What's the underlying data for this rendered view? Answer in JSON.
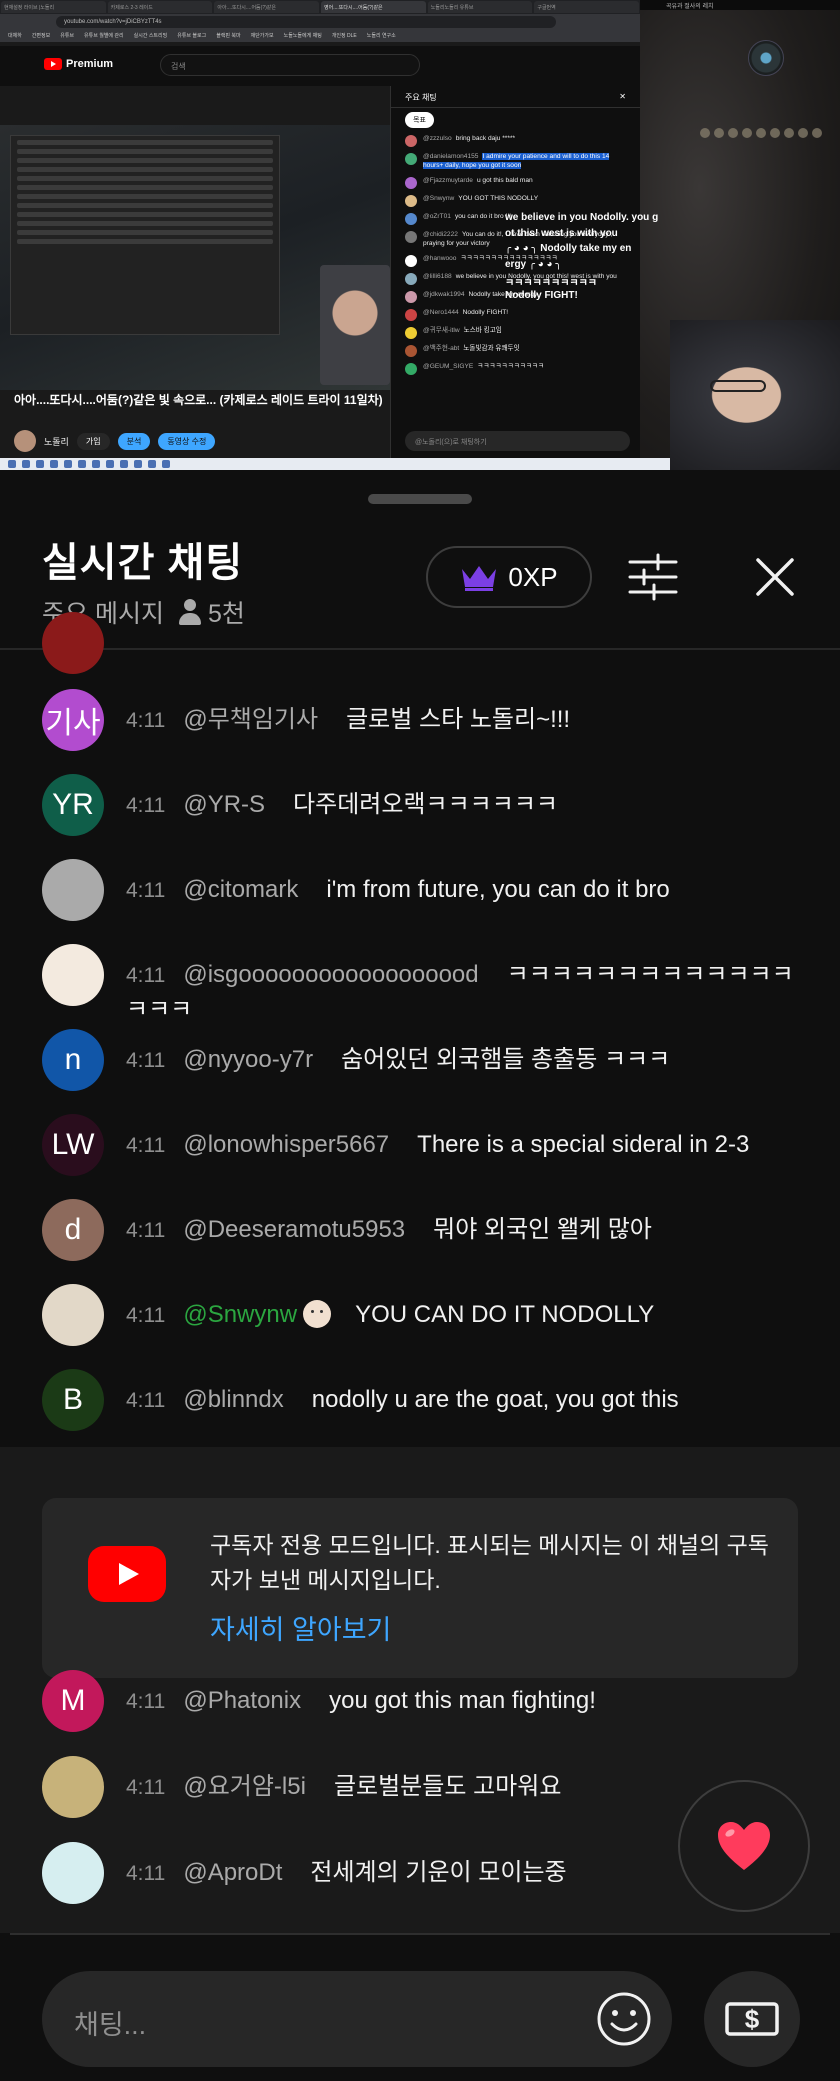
{
  "video_frame": {
    "browser_tabs": [
      "현재설정 라이브 |노돌리",
      "카제로스 2-3 레이드",
      "아아....또다시....어둠(?)같은",
      "영어....또다시....어둠(?)같은",
      "노돌리노돌리 유튜브",
      "구글번역"
    ],
    "browser_url": "youtube.com/watch?v=jDiCBYzTT4s",
    "bookmarks": [
      "대체하",
      "간편정보",
      "유튜브",
      "유튜브 월별에 관리",
      "실시간 스트리밍",
      "유튜브 블로그",
      "블랙핀 북마",
      "재단가가보",
      "노돌노돌에게 채팅",
      "개인정 DLE",
      "노돌리 연구소"
    ],
    "yt_logo_text": "Premium",
    "yt_search_placeholder": "검색",
    "video_title": "아아....또다시....어둠(?)같은 빛 속으로... (카제로스 레이드 트라이 11일차)",
    "channel_name": "노돌리",
    "channel_buttons": [
      "가입",
      "분석",
      "동영상 수정"
    ],
    "mini_chat": {
      "header": "주요 채팅",
      "pill": "목표",
      "rows": [
        {
          "name": "@zzzulso",
          "text": "bring back daju *****",
          "color": "#c66"
        },
        {
          "name": "@danielamon4155",
          "text": "I admire your patience and will to do this 14 hours+ daily, hope you got it soon",
          "color": "#4a7",
          "highlight": true
        },
        {
          "name": "@Fjazzmuytarde",
          "text": "u got this bald man",
          "color": "#a6c"
        },
        {
          "name": "@Snwynw",
          "text": "YOU GOT THIS NODOLLY",
          "color": "#db8"
        },
        {
          "name": "@oZrT01",
          "text": "you can do it bro !!!",
          "color": "#58c"
        },
        {
          "name": "@chidi2222",
          "text": "You can do it!, I have been watching you everyday , praying for your victory",
          "color": "#777"
        },
        {
          "name": "@hanwooo",
          "text": "ㅋㅋㅋㅋㅋㅋㅋㅋㅋㅋㅋㅋㅋㅋㅋㅋ",
          "color": "#fff"
        },
        {
          "name": "@lilli6188",
          "text": "we believe in you Nodolly. you got this! west is with you",
          "color": "#8ab"
        },
        {
          "name": "@jdkwak1994",
          "text": "Nodolly take my energy",
          "color": "#c9a"
        },
        {
          "name": "@Nero1444",
          "text": "Nodolly FIGHT!",
          "color": "#c44"
        },
        {
          "name": "@귀무새-itlw",
          "text": "노스바 킹고임",
          "color": "#ec3"
        },
        {
          "name": "@백주현-abt",
          "text": "노돌빛감과 유쾌두잇",
          "color": "#a53"
        },
        {
          "name": "@GEUM_SIGYE",
          "text": "ㅋㅋㅋㅋㅋㅋㅋㅋㅋㅋㅋ",
          "color": "#3a6"
        }
      ],
      "input_placeholder": "@노돌리(으)로 채팅하기"
    },
    "game_overlay": {
      "top_label": "곡유과 절사의 레치",
      "chat_lines": [
        "we believe in you Nodolly. you g",
        "ot this! west is with you",
        "╭ ◕ ◕ ╮ Nodolly take my en",
        "ergy ╭ ◕ ◕ ╮",
        "ㅋㅋㅋㅋㅋㅋㅋㅋㅋㅋ",
        "Nodolly FIGHT!"
      ]
    }
  },
  "chat_panel": {
    "title": "실시간 채팅",
    "mode_label": "주요 메시지",
    "viewer_count": "5천",
    "xp_label": "0XP",
    "accent_color": "#7b3fe4",
    "messages_top": [
      {
        "avatar_text": "기사",
        "avatar_color": "#b24ccf",
        "time": "4:11",
        "author": "@무책임기사",
        "text": "글로벌 스타 노돌리~!!!"
      },
      {
        "avatar_text": "YR",
        "avatar_color": "#0f5e49",
        "time": "4:11",
        "author": "@YR-S",
        "text": "다주데려오랙ㅋㅋㅋㅋㅋㅋ"
      },
      {
        "avatar_text": "",
        "avatar_color": "#aaaaaa",
        "time": "4:11",
        "author": "@citomark",
        "text": "i'm from future, you can do it bro"
      },
      {
        "avatar_text": "",
        "avatar_color": "#f3eadf",
        "avatar_icon": "thumbs-up-icon",
        "time": "4:11",
        "author": "@isgoooooooooooooooood",
        "text": "ㅋㅋㅋㅋㅋㅋㅋㅋㅋㅋㅋㅋㅋㅋㅋㅋ"
      },
      {
        "avatar_text": "n",
        "avatar_color": "#1156a8",
        "time": "4:11",
        "author": "@nyyoo-y7r",
        "text": "숨어있던 외국햄들 총출동 ㅋㅋㅋ"
      },
      {
        "avatar_text": "LW",
        "avatar_color": "#2a0d1d",
        "time": "4:11",
        "author": "@lonowhisper5667",
        "text": "There is a special sideral in 2-3"
      },
      {
        "avatar_text": "d",
        "avatar_color": "#8d6a5c",
        "time": "4:11",
        "author": "@Deeseramotu5953",
        "text": "뭐야 외국인 왤케 많아"
      },
      {
        "avatar_text": "",
        "avatar_color": "#e2d8c8",
        "avatar_icon": "dog-avatar-icon",
        "time": "4:11",
        "author": "@Snwynw",
        "member": true,
        "text": "YOU CAN DO IT NODOLLY"
      },
      {
        "avatar_text": "B",
        "avatar_color": "#1b3a16",
        "time": "4:11",
        "author": "@blinndx",
        "text": "nodolly u are the goat, you got this"
      }
    ],
    "subscriber_notice": {
      "text": "구독자 전용 모드입니다. 표시되는 메시지는 이 채널의 구독자가 보낸 메시지입니다.",
      "link": "자세히 알아보기"
    },
    "messages_bottom": [
      {
        "avatar_text": "M",
        "avatar_color": "#c2185b",
        "time": "4:11",
        "author": "@Phatonix",
        "text": "you got this man fighting!"
      },
      {
        "avatar_text": "",
        "avatar_color": "#c7b27a",
        "avatar_icon": "cake-avatar-icon",
        "time": "4:11",
        "author": "@요거얌-l5i",
        "text": "글로벌분들도 고마워요"
      },
      {
        "avatar_text": "",
        "avatar_color": "#d6eef0",
        "avatar_icon": "anime-avatar-icon",
        "time": "4:11",
        "author": "@AproDt",
        "text": "전세계의 기운이 모이는중"
      }
    ],
    "input_placeholder": "채팅...",
    "heart_color": "#ff3b5c"
  }
}
